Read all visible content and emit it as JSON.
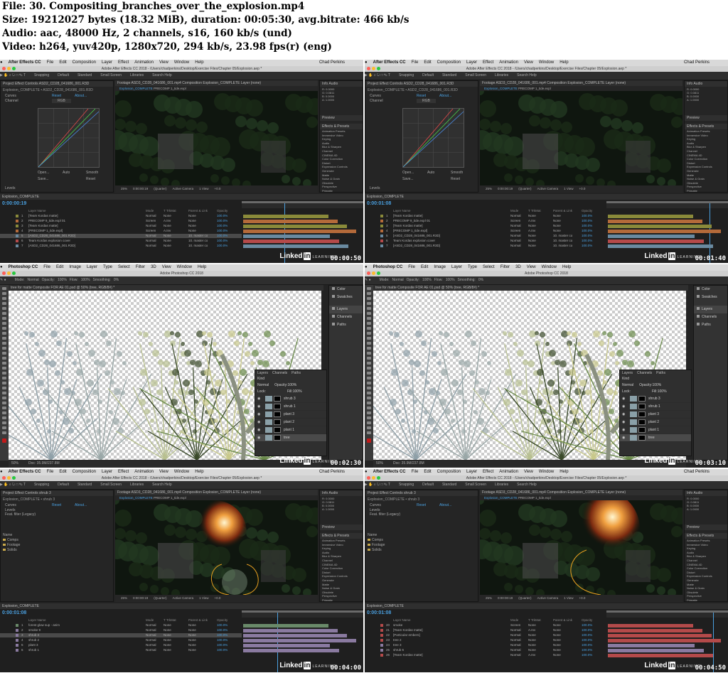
{
  "header": {
    "file_line": "File: 30. Compositing_branches_over_the_explosion.mp4",
    "size_line": "Size: 19212027 bytes (18.32 MiB), duration: 00:05:30, avg.bitrate: 466 kb/s",
    "audio_line": "Audio: aac, 48000 Hz, 2 channels, s16, 160 kb/s (und)",
    "video_line": "Video: h264, yuv420p, 1280x720, 294 kb/s, 23.98 fps(r) (eng)"
  },
  "ae": {
    "app": "After Effects CC",
    "menus": [
      "File",
      "Edit",
      "Composition",
      "Layer",
      "Effect",
      "Animation",
      "View",
      "Window",
      "Help"
    ],
    "user": "Chad Perkins",
    "window_title": "Adobe After Effects CC 2018 - /Users/chadperkins/Desktop/Exercise Files/Chapter 05/Explosion.aep *",
    "workspaces": [
      "Default",
      "Standard",
      "Small Screen",
      "Libraries"
    ],
    "snapping": "Snapping",
    "search_help": "Search Help",
    "project_tab": "Project",
    "effect_controls_1": "Effect Controls ASD2_CD28_041686_001.R3D",
    "effect_controls_2": "Effect Controls shrub 3",
    "footage_tab": "Footage ASD3_CD28_041686_001.mp4",
    "comp_tab": "Composition Explosion_COMPLETE",
    "layer_tab": "Layer (none)",
    "comp_name": "Explosion_COMPLETE",
    "precomp_name": "PRECOMP 1_tide.expl",
    "effect_path_1": "Explosion_COMPLETE • ASD2_CD28_041686_001.R3D",
    "effect_path_2": "Explosion_COMPLETE • shrub 3",
    "curves": "Curves",
    "channel_label": "Channel",
    "channel_value": "RGB",
    "reset": "Reset",
    "about": "About...",
    "curve_buttons": [
      "Open...",
      "Auto",
      "Smooth",
      "Save...",
      "Reset"
    ],
    "levels": "Levels",
    "feather": "Feat. filter (Legacy)",
    "info_tab": "Info",
    "audio_tab": "Audio",
    "info_values": [
      "R: 0.0000",
      "G: 0.0811",
      "B: 0.0000",
      "A: 1.0000"
    ],
    "project_items": [
      "Name",
      "Comps",
      "Footage",
      "Solids"
    ],
    "preview_tab": "Preview",
    "effects_presets_tab": "Effects & Presets",
    "effects_list": [
      "Animation Presets",
      "Immersive Video",
      "Keying",
      "Audio",
      "Blur & Sharpen",
      "Channel",
      "CINEMA 4D",
      "Color Correction",
      "Distort",
      "Expression Controls",
      "Generate",
      "Matte",
      "Noise & Grain",
      "Obsolete",
      "Perspective",
      "Primatte",
      "Red Giant",
      "Red Giant Shooter Suite",
      "Red Giant Warp",
      "RG Magic Bullet"
    ],
    "viewer_controls": [
      "25%",
      "0:00:00:19",
      "(Quarter)",
      "Active Camera",
      "1 View",
      "+0.0"
    ],
    "timecodes": [
      "0:00:00:19",
      "0:00:01:08",
      "0:00:01:08",
      "0:00:01:08"
    ],
    "col_headers": [
      "Layer Name",
      "Mode",
      "T TrkMat",
      "Parent & Link",
      "Opacity"
    ],
    "layers_top": [
      {
        "n": "1",
        "name": "[Team Kordas matte]",
        "mode": "Normal",
        "tm": "None",
        "par": "None",
        "op": "100.0%",
        "c": "#8a8a3a"
      },
      {
        "n": "2",
        "name": "PRECOMP 9_tide.expl 01",
        "mode": "Screen",
        "tm": "A.Inv",
        "par": "None",
        "op": "100.0%",
        "c": "#b46a3a"
      },
      {
        "n": "3",
        "name": "[Team Kordas matte]",
        "mode": "Normal",
        "tm": "None",
        "par": "None",
        "op": "100.0%",
        "c": "#8a8a3a"
      },
      {
        "n": "4",
        "name": "[PRECOMP 1_tide.expl]",
        "mode": "Screen",
        "tm": "A.Inv",
        "par": "None",
        "op": "100.0%",
        "c": "#b46a3a"
      },
      {
        "n": "5",
        "name": "[ASD2_CD28_041686_001.R3D]",
        "mode": "Normal",
        "tm": "None",
        "par": "10. master co",
        "op": "100.0%",
        "c": "#6a8aa0"
      },
      {
        "n": "6",
        "name": "Team Kordas explosion cover",
        "mode": "Normal",
        "tm": "None",
        "par": "10. master co",
        "op": "100.0%",
        "c": "#b44a4a"
      },
      {
        "n": "7",
        "name": "[ASD2_CD28_041686_001.R3D]",
        "mode": "Normal",
        "tm": "None",
        "par": "10. master co",
        "op": "100.0%",
        "c": "#6a8aa0"
      }
    ],
    "layers_bl": [
      {
        "n": "1",
        "name": "forest glow sup - anim",
        "mode": "Normal",
        "tm": "None",
        "par": "None",
        "op": "100.0%",
        "c": "#6a8a6a"
      },
      {
        "n": "2",
        "name": "smoke 9",
        "mode": "Normal",
        "tm": "None",
        "par": "None",
        "op": "100.0%",
        "c": "#8a7aa0"
      },
      {
        "n": "3",
        "name": "shrub 3",
        "mode": "Normal",
        "tm": "None",
        "par": "None",
        "op": "100.0%",
        "c": "#8a7aa0"
      },
      {
        "n": "4",
        "name": "shrub 2",
        "mode": "Normal",
        "tm": "None",
        "par": "None",
        "op": "100.0%",
        "c": "#8a7aa0"
      },
      {
        "n": "5",
        "name": "plant 3",
        "mode": "Normal",
        "tm": "None",
        "par": "None",
        "op": "100.0%",
        "c": "#8a7aa0"
      },
      {
        "n": "6",
        "name": "shrub 1",
        "mode": "Normal",
        "tm": "None",
        "par": "None",
        "op": "100.0%",
        "c": "#8a7aa0"
      }
    ],
    "layers_br": [
      {
        "n": "20",
        "name": "smoke",
        "mode": "Screen",
        "tm": "None",
        "par": "None",
        "op": "100.0%",
        "c": "#b44a4a"
      },
      {
        "n": "21",
        "name": "[Team Kordas matte]",
        "mode": "Normal",
        "tm": "A.Inv",
        "par": "None",
        "op": "100.0%",
        "c": "#b44a4a"
      },
      {
        "n": "22",
        "name": "[Particular embers]",
        "mode": "Normal",
        "tm": "None",
        "par": "None",
        "op": "100.0%",
        "c": "#b44a4a"
      },
      {
        "n": "23",
        "name": "tree 2",
        "mode": "Normal",
        "tm": "None",
        "par": "None",
        "op": "100.0%",
        "c": "#b44a4a"
      },
      {
        "n": "24",
        "name": "tree 3",
        "mode": "Normal",
        "tm": "None",
        "par": "None",
        "op": "100.0%",
        "c": "#8a7aa0"
      },
      {
        "n": "25",
        "name": "shrub 6",
        "mode": "Normal",
        "tm": "None",
        "par": "None",
        "op": "100.0%",
        "c": "#8a7aa0"
      },
      {
        "n": "26",
        "name": "[Team Kordas matte]",
        "mode": "Normal",
        "tm": "A.Inv",
        "par": "None",
        "op": "100.0%",
        "c": "#b44a4a"
      }
    ]
  },
  "ps": {
    "app": "Photoshop CC",
    "menus": [
      "File",
      "Edit",
      "Image",
      "Layer",
      "Type",
      "Select",
      "Filter",
      "3D",
      "View",
      "Window",
      "Help"
    ],
    "window_title": "Adobe Photoshop CC 2018",
    "doc_tab": "tree for matte Composite FOR AE 01.psd @ 50% (tree, RGB/8#) *",
    "options": [
      "Mode:",
      "Normal",
      "Opacity:",
      "100%",
      "Flow:",
      "100%",
      "Smoothing:",
      "0%"
    ],
    "layers_tabs": [
      "Layers",
      "Channels",
      "Paths"
    ],
    "kind": "Kind",
    "blend": "Normal",
    "opacity_label": "Opacity:",
    "opacity_value": "100%",
    "lock_label": "Lock:",
    "fill_label": "Fill:",
    "fill_value": "100%",
    "layers": [
      "shrub 3",
      "shrub 1",
      "plant 3",
      "plant 2",
      "plant 1",
      "tree"
    ],
    "right_panels": [
      "Color",
      "Swatches",
      "Layers",
      "Channels",
      "Paths"
    ],
    "status_zoom": "50%",
    "status_doc": "Doc: 35.9M/237.8M"
  },
  "thumbs": [
    {
      "time": "00:00:50"
    },
    {
      "time": "00:01:40"
    },
    {
      "time": "00:02:30"
    },
    {
      "time": "00:03:10"
    },
    {
      "time": "00:04:00"
    },
    {
      "time": "00:04:50"
    }
  ],
  "watermark": {
    "linked": "Linked",
    "in": "in",
    "learning": "LEARNING"
  }
}
